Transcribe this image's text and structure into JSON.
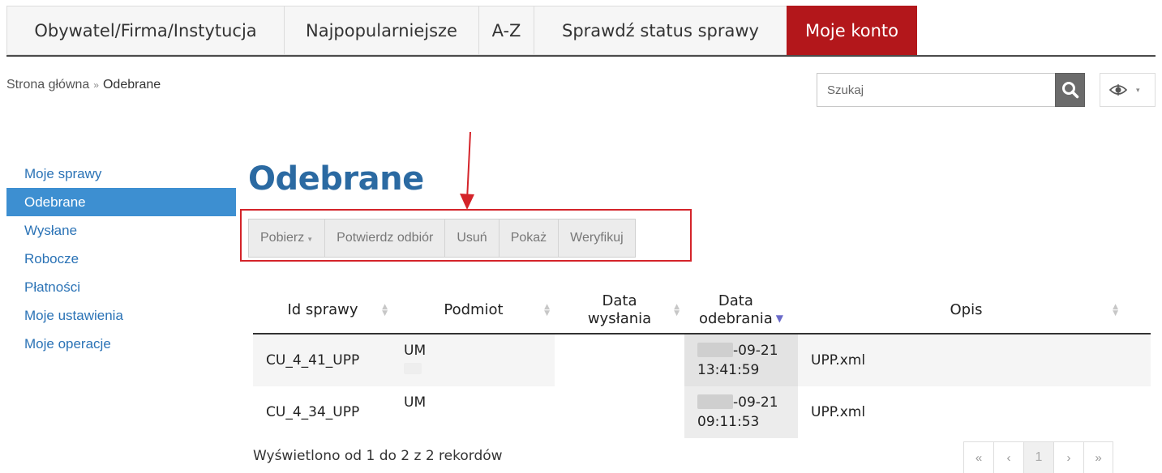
{
  "topnav": {
    "tabs": [
      {
        "label": "Obywatel/Firma/Instytucja",
        "active": false
      },
      {
        "label": "Najpopularniejsze",
        "active": false
      },
      {
        "label": "A-Z",
        "active": false
      },
      {
        "label": "Sprawdź status sprawy",
        "active": false
      },
      {
        "label": "Moje konto",
        "active": true
      }
    ]
  },
  "breadcrumb": {
    "home": "Strona główna",
    "separator": "»",
    "current": "Odebrane"
  },
  "search": {
    "placeholder": "Szukaj",
    "icon": "search-icon"
  },
  "accessibility": {
    "icon": "eye-icon",
    "caret": "▾"
  },
  "sidebar": {
    "items": [
      {
        "label": "Moje sprawy",
        "active": false
      },
      {
        "label": "Odebrane",
        "active": true
      },
      {
        "label": "Wysłane",
        "active": false
      },
      {
        "label": "Robocze",
        "active": false
      },
      {
        "label": "Płatności",
        "active": false
      },
      {
        "label": "Moje ustawienia",
        "active": false
      },
      {
        "label": "Moje operacje",
        "active": false
      }
    ]
  },
  "main": {
    "title": "Odebrane",
    "toolbar": {
      "pobierz": "Pobierz",
      "potwierdz": "Potwierdz odbiór",
      "usun": "Usuń",
      "pokaz": "Pokaż",
      "weryfikuj": "Weryfikuj"
    },
    "table": {
      "columns": {
        "id": "Id sprawy",
        "podmiot": "Podmiot",
        "data_wyslania_1": "Data",
        "data_wyslania_2": "wysłania",
        "data_odebrania_1": "Data",
        "data_odebrania_2": "odebrania",
        "opis": "Opis"
      },
      "rows": [
        {
          "id": "CU_4_41_UPP",
          "podmiot": "UM",
          "date_suffix": "-09-21",
          "time": "13:41:59",
          "opis": "UPP.xml"
        },
        {
          "id": "CU_4_34_UPP",
          "podmiot": "UM",
          "date_suffix": "-09-21",
          "time": "09:11:53",
          "opis": "UPP.xml"
        }
      ]
    },
    "footer_info": "Wyświetlono od 1 do 2 z 2 rekordów",
    "pagination": {
      "first": "«",
      "prev": "‹",
      "current": "1",
      "next": "›",
      "last": "»"
    }
  },
  "colors": {
    "active_tab": "#b3171b",
    "sidebar_active": "#3d8fd1",
    "link": "#2b73b6",
    "title": "#2b6aa2",
    "highlight_frame": "#d4242a"
  }
}
